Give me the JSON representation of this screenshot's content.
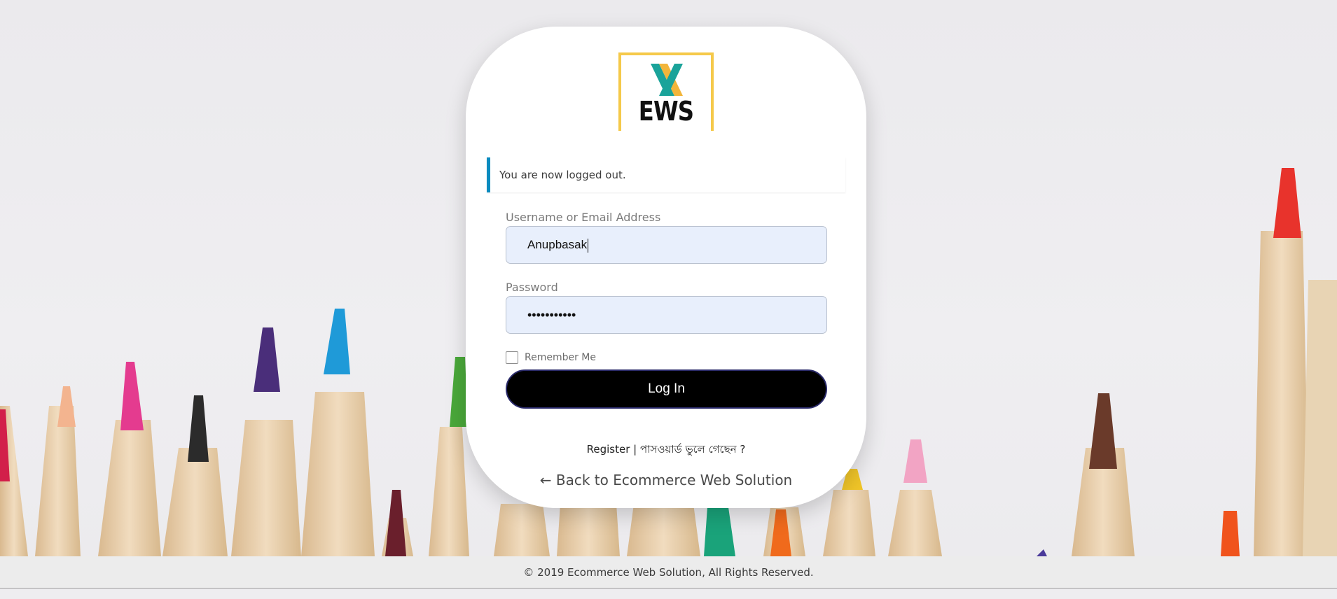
{
  "logo": {
    "text": "EWS",
    "mark": "X",
    "colors": {
      "frame": "#f5c94a",
      "x_teal": "#1aa39a",
      "x_gold": "#f2b53a"
    }
  },
  "notice": {
    "text": "You are now logged out.",
    "accent": "#0a8bbf"
  },
  "username": {
    "label": "Username or Email Address",
    "value": "Anupbasak"
  },
  "password": {
    "label": "Password",
    "masked_value": "•••••••••••"
  },
  "remember": {
    "label": "Remember Me",
    "checked": false
  },
  "login_button": {
    "label": "Log In"
  },
  "links": {
    "register": "Register",
    "separator": " | ",
    "forgot": "পাসওয়ার্ড ভুলে গেছেন ?"
  },
  "back_link": {
    "label": "← Back to Ecommerce Web Solution"
  },
  "footer": {
    "text": "© 2019 Ecommerce Web Solution, All Rights Reserved."
  },
  "icons": [
    "logo-icon",
    "checkbox-icon"
  ]
}
